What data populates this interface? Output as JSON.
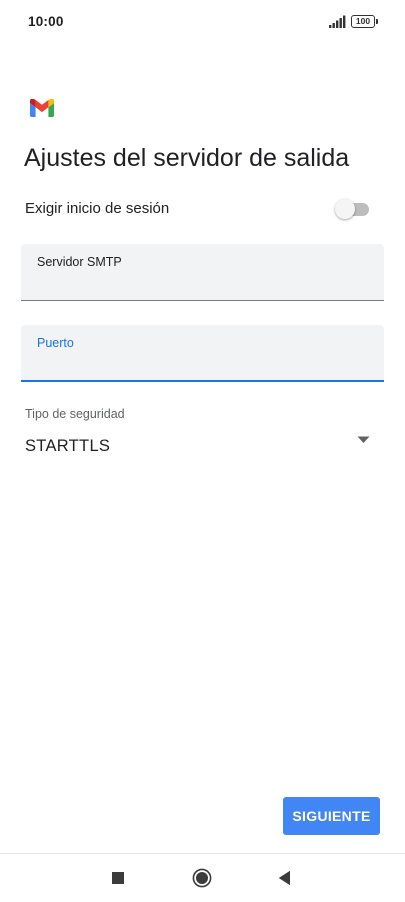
{
  "status_bar": {
    "time": "10:00",
    "battery_level": "100",
    "icons": [
      "signal-icon",
      "battery-icon"
    ]
  },
  "app": {
    "logo": "gmail-logo",
    "colors": {
      "accent": "#1a73e8",
      "button": "#4285f4",
      "field_background": "#f1f3f4",
      "gmail_red": "#ea4335",
      "gmail_blue": "#4285f4",
      "gmail_green": "#34a853",
      "gmail_yellow": "#fbbc04"
    }
  },
  "page": {
    "title": "Ajustes del servidor de salida"
  },
  "require_login": {
    "label": "Exigir inicio de sesión",
    "enabled": false
  },
  "smtp_server": {
    "label": "Servidor SMTP",
    "value": ""
  },
  "port": {
    "label": "Puerto",
    "value": "",
    "focused": true
  },
  "security_type": {
    "label": "Tipo de seguridad",
    "selected": "STARTTLS"
  },
  "actions": {
    "next_label": "SIGUIENTE"
  },
  "nav_bar": {
    "buttons": [
      "recents-icon",
      "home-icon",
      "back-icon"
    ]
  }
}
